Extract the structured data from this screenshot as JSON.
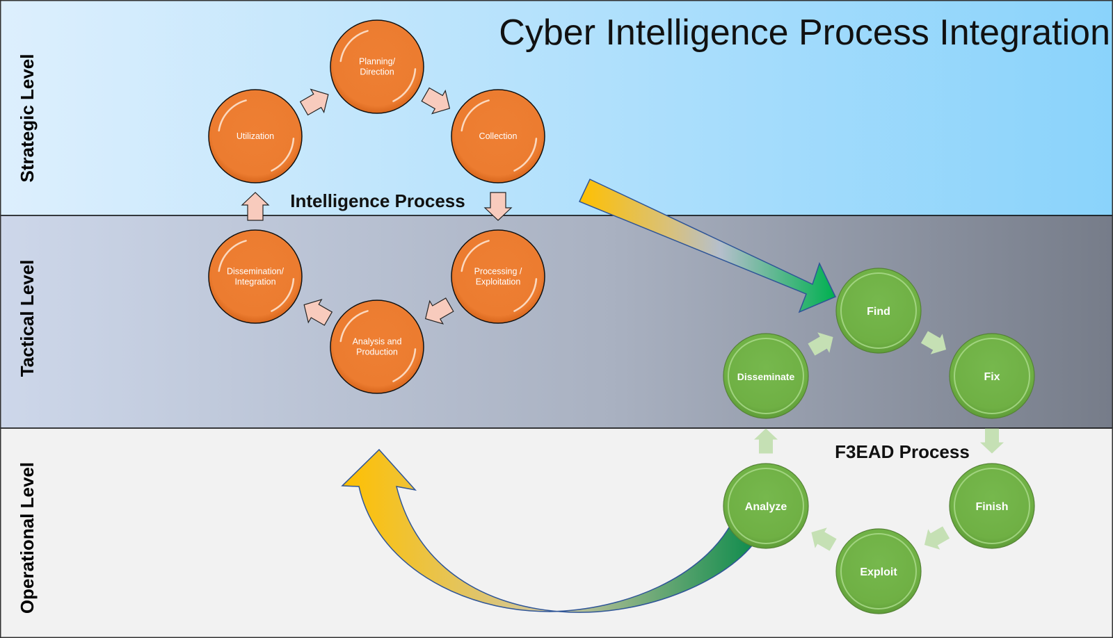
{
  "title": "Cyber Intelligence Process Integration",
  "levels": [
    {
      "id": "strategic",
      "label": "Strategic Level",
      "color_left": "#dbeefd",
      "color_right": "#8dd4fb"
    },
    {
      "id": "tactical",
      "label": "Tactical Level",
      "color_left": "#ccd6e8",
      "color_right": "#767d8a"
    },
    {
      "id": "operational",
      "label": "Operational Level",
      "color_left": "#f2f2f2",
      "color_right": "#f2f2f2"
    }
  ],
  "intelligence_process": {
    "title": "Intelligence Process",
    "color": "#ed7d31",
    "arrow_color": "#f8cbbd",
    "steps": [
      {
        "lines": [
          "Planning/",
          "Direction"
        ]
      },
      {
        "lines": [
          "Collection"
        ]
      },
      {
        "lines": [
          "Processing /",
          "Exploitation"
        ]
      },
      {
        "lines": [
          "Analysis and",
          "Production"
        ]
      },
      {
        "lines": [
          "Dissemination/",
          "Integration"
        ]
      },
      {
        "lines": [
          "Utilization"
        ]
      }
    ]
  },
  "f3ead_process": {
    "title": "F3EAD Process",
    "color": "#70ad47",
    "arrow_color": "#c5e0b4",
    "steps": [
      {
        "label": "Find"
      },
      {
        "label": "Fix"
      },
      {
        "label": "Finish"
      },
      {
        "label": "Exploit"
      },
      {
        "label": "Analyze"
      },
      {
        "label": "Disseminate"
      }
    ]
  },
  "connectors": {
    "intel_to_f3ead": {
      "from": "Intelligence Process",
      "to": "Find",
      "gradient": [
        "#ffc000",
        "#b4c0d0",
        "#00b050"
      ]
    },
    "analyze_to_intel": {
      "from": "Analyze",
      "to": "Intelligence Process",
      "gradient": [
        "#ffc000",
        "#c8c8b0",
        "#0b8c4c"
      ]
    }
  }
}
